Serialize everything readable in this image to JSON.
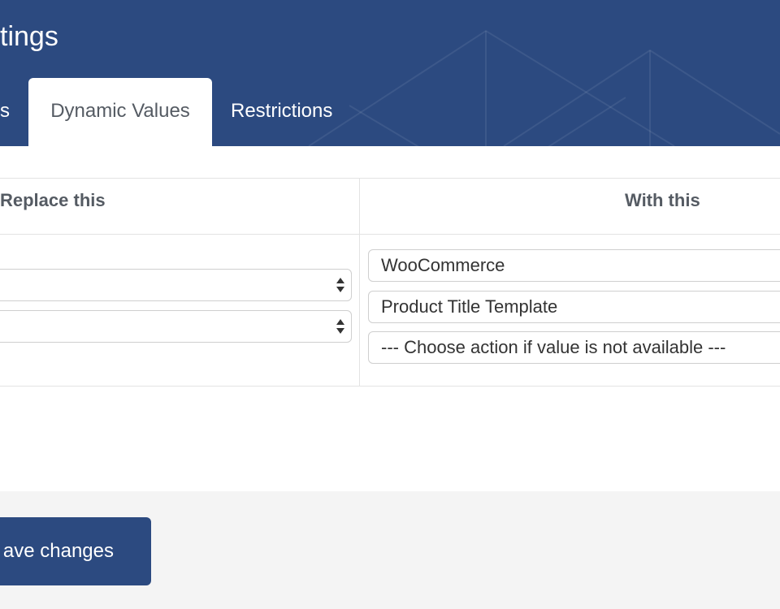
{
  "header": {
    "title": "tings",
    "tabs": [
      {
        "label": "s",
        "active": false
      },
      {
        "label": "Dynamic Values",
        "active": true
      },
      {
        "label": "Restrictions",
        "active": false
      }
    ]
  },
  "table": {
    "col_replace": "Replace this",
    "col_with": "With this",
    "left_selects": [
      {
        "value": ""
      },
      {
        "value": ""
      }
    ],
    "right_selects": [
      {
        "value": "WooCommerce"
      },
      {
        "value": "Product Title Template"
      },
      {
        "value": "--- Choose action if value is not available ---"
      }
    ]
  },
  "footer": {
    "save_label": "ave changes"
  },
  "colors": {
    "header_bg": "#2c4a80",
    "panel_bg": "#ffffff",
    "footer_bg": "#f4f4f4",
    "text_dark": "#555b63"
  }
}
